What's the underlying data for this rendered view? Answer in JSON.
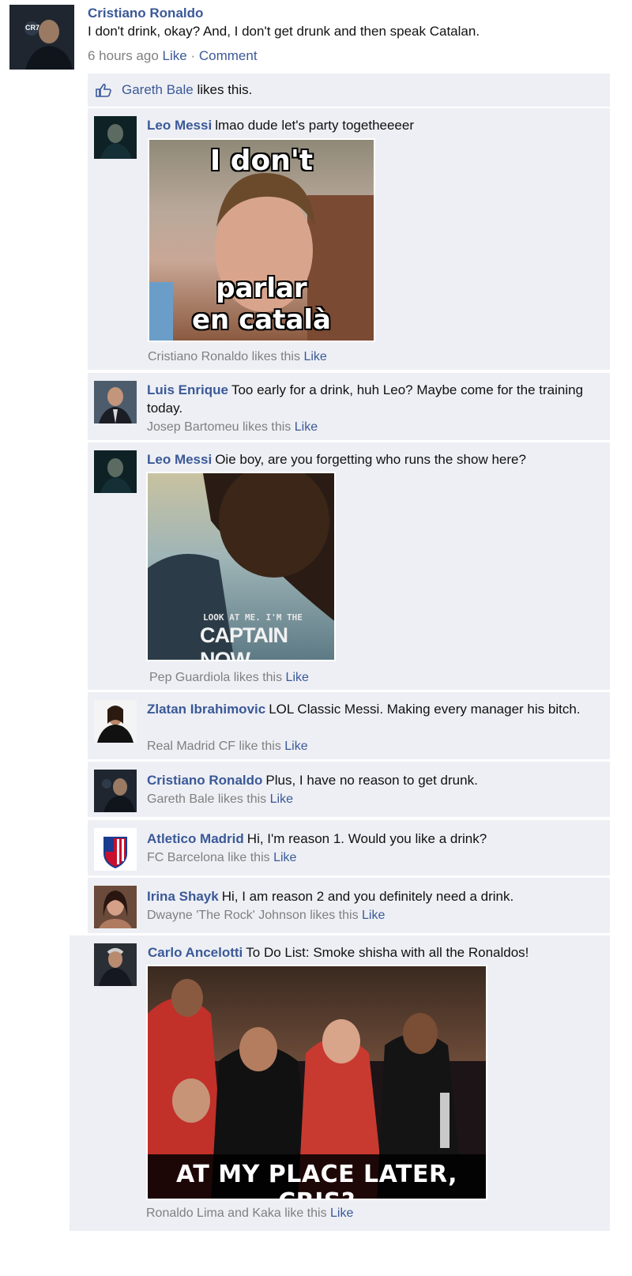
{
  "post": {
    "author": "Cristiano Ronaldo",
    "text": "I don't drink, okay? And, I don't get drunk and then speak Catalan.",
    "time": "6 hours ago",
    "like_label": "Like",
    "dot": "·",
    "comment_label": "Comment",
    "avatar_icon": "profile-photo",
    "avatar_logo_text": "CR7"
  },
  "likes_bar": {
    "name": "Gareth Bale",
    "text": "likes this."
  },
  "comments": [
    {
      "author": "Leo Messi",
      "text": "lmao dude let's party togetheeeer",
      "likes": "Cristiano Ronaldo likes this",
      "like_label": "Like",
      "meme": {
        "top": "I don't",
        "bottom1": "parlar",
        "bottom2": "en català"
      }
    },
    {
      "author": "Luis Enrique",
      "text": "Too early for a drink, huh Leo? Maybe come for the training today.",
      "likes": "Josep Bartomeu likes this",
      "like_label": "Like"
    },
    {
      "author": "Leo Messi",
      "text": "Oie boy, are you forgetting who runs the show here?",
      "likes": "Pep Guardiola likes this",
      "like_label": "Like",
      "meme": {
        "small": "LOOK AT ME. I'M THE",
        "big": "CAPTAIN NOW."
      }
    },
    {
      "author": "Zlatan Ibrahimovic",
      "text": "LOL Classic Messi. Making every manager his bitch.",
      "likes": "Real Madrid CF like this",
      "like_label": "Like"
    },
    {
      "author": "Cristiano Ronaldo",
      "text": "Plus, I have no reason to get drunk.",
      "likes": "Gareth Bale likes this",
      "like_label": "Like"
    },
    {
      "author": "Atletico Madrid",
      "text": "Hi, I'm reason 1. Would you like a drink?",
      "likes": "FC Barcelona like this",
      "like_label": "Like"
    },
    {
      "author": "Irina Shayk",
      "text": "Hi, I am reason 2 and you definitely need a drink.",
      "likes": "Dwayne 'The Rock' Johnson likes this",
      "like_label": "Like"
    },
    {
      "author": "Carlo Ancelotti",
      "text": "To Do List: Smoke shisha with all the Ronaldos!",
      "likes": "Ronaldo Lima and Kaka like this",
      "like_label": "Like",
      "meme": {
        "caption": "AT MY PLACE LATER, CRIS?"
      }
    }
  ],
  "colors": {
    "link": "#3b5998",
    "meta": "#808080",
    "panel": "#edeff4"
  }
}
